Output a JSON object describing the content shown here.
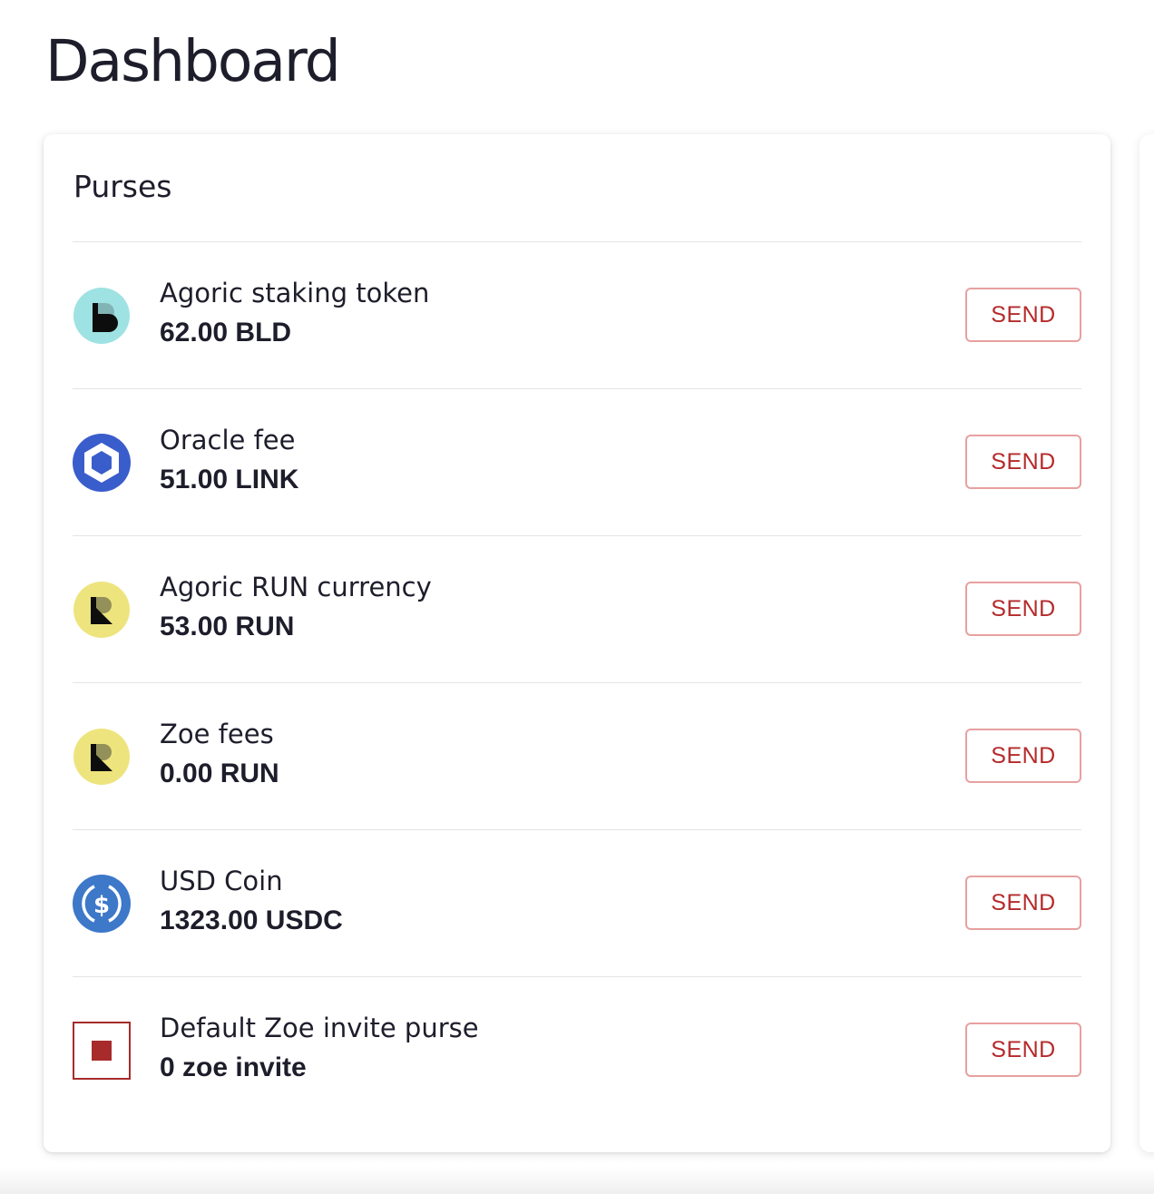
{
  "page": {
    "title": "Dashboard"
  },
  "purses_card": {
    "title": "Purses",
    "items": [
      {
        "name": "Agoric staking token",
        "balance": "62.00 BLD",
        "icon": "bld-token-icon",
        "send_label": "SEND"
      },
      {
        "name": "Oracle fee",
        "balance": "51.00 LINK",
        "icon": "link-token-icon",
        "send_label": "SEND"
      },
      {
        "name": "Agoric RUN currency",
        "balance": "53.00 RUN",
        "icon": "run-token-icon",
        "send_label": "SEND"
      },
      {
        "name": "Zoe fees",
        "balance": "0.00 RUN",
        "icon": "run-token-icon",
        "send_label": "SEND"
      },
      {
        "name": "USD Coin",
        "balance": "1323.00 USDC",
        "icon": "usdc-token-icon",
        "send_label": "SEND"
      },
      {
        "name": "Default Zoe invite purse",
        "balance": "0 zoe invite",
        "icon": "zoe-invite-icon",
        "send_label": "SEND"
      }
    ]
  },
  "colors": {
    "send_text": "#b52a2a",
    "send_border": "#e8a0a0",
    "bld_bg": "#9fe2e3",
    "link_blue": "#3a5dcc",
    "run_bg": "#eee47e",
    "usdc_blue": "#3d78c9",
    "invite_red": "#a72b2b"
  }
}
